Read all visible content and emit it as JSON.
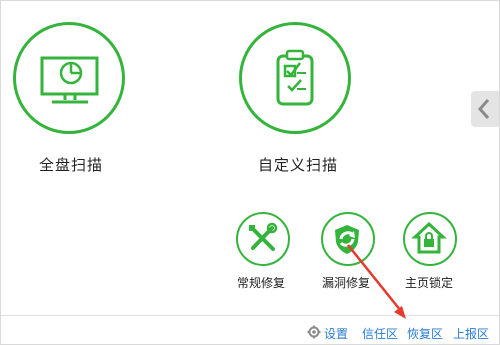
{
  "scan": {
    "full_scan_label": "全盘扫描",
    "custom_scan_label": "自定义扫描"
  },
  "tools": {
    "repair_label": "常规修复",
    "vuln_label": "漏洞修复",
    "homepage_lock_label": "主页锁定"
  },
  "footer": {
    "settings_label": "设置",
    "trust_label": "信任区",
    "restore_label": "恢复区",
    "report_label": "上报区"
  },
  "colors": {
    "accent": "#35b43c",
    "link": "#2a7cd6",
    "annotation": "#e63a2e"
  },
  "icons": {
    "full_scan": "monitor-icon",
    "custom_scan": "checklist-icon",
    "repair": "wrench-screwdriver-icon",
    "vuln": "shield-refresh-icon",
    "homepage_lock": "house-lock-icon",
    "settings": "gear-icon",
    "expand": "chevron-left-icon"
  }
}
